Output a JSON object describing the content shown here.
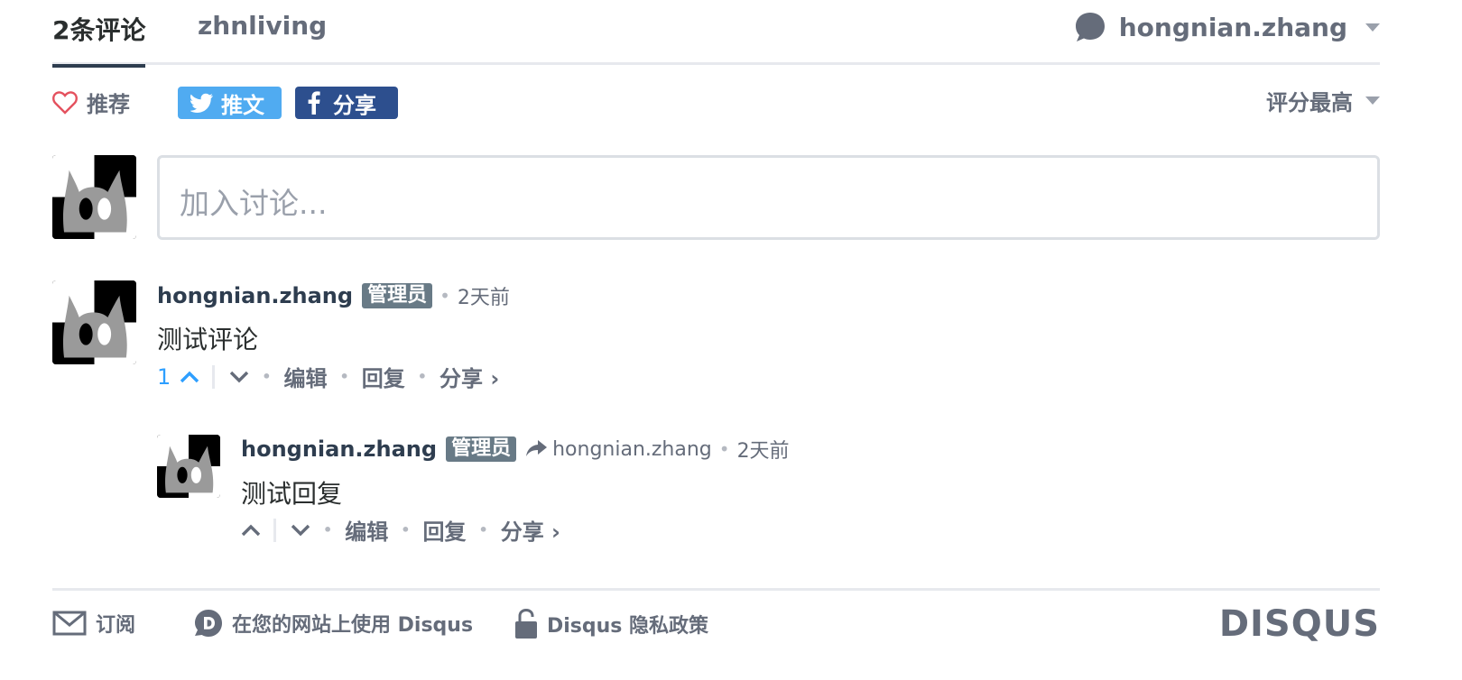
{
  "nav": {
    "comments_tab": "2条评论",
    "forum_tab": "zhnliving",
    "user_name": "hongnian.zhang"
  },
  "actions": {
    "recommend_label": "推荐",
    "tweet_label": "推文",
    "share_label": "分享",
    "sort_label": "评分最高"
  },
  "composer": {
    "placeholder": "加入讨论..."
  },
  "comments": [
    {
      "author": "hongnian.zhang",
      "badge": "管理员",
      "time": "2天前",
      "text": "测试评论",
      "votes": "1",
      "edit": "编辑",
      "reply": "回复",
      "share": "分享 ›"
    }
  ],
  "reply": {
    "author": "hongnian.zhang",
    "badge": "管理员",
    "reply_to": "hongnian.zhang",
    "time": "2天前",
    "text": "测试回复",
    "edit": "编辑",
    "reply": "回复",
    "share": "分享 ›"
  },
  "footer": {
    "subscribe": "订阅",
    "use_disqus": "在您的网站上使用 Disqus",
    "privacy": "Disqus 隐私政策",
    "brand": "DISQUS"
  },
  "colors": {
    "accent_blue": "#2e9fff",
    "twitter": "#50abf1",
    "facebook": "#2d4f8e",
    "badge": "#687a86"
  }
}
